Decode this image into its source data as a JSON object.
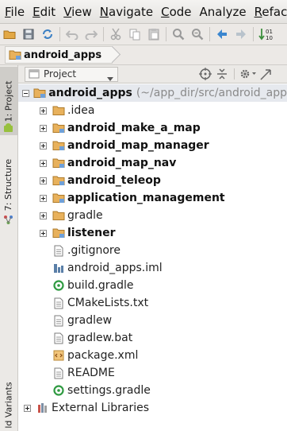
{
  "menu": [
    {
      "mn": "F",
      "rest": "ile"
    },
    {
      "mn": "E",
      "rest": "dit"
    },
    {
      "mn": "V",
      "rest": "iew"
    },
    {
      "mn": "N",
      "rest": "avigate"
    },
    {
      "mn": "C",
      "rest": "ode"
    },
    {
      "mn": "",
      "rest": "Analyze"
    },
    {
      "mn": "R",
      "rest": "efact"
    }
  ],
  "breadcrumb": {
    "label": "android_apps"
  },
  "side_tabs": {
    "project": "1: Project",
    "structure": "7: Structure",
    "variants": "ld Variants"
  },
  "panel": {
    "view_label": "Project"
  },
  "tree": {
    "root": {
      "name": "android_apps",
      "path": "(~/app_dir/src/android_app"
    },
    "items": [
      {
        "name": ".idea",
        "bold": false,
        "expandable": true,
        "icon": "folder-icon"
      },
      {
        "name": "android_make_a_map",
        "bold": true,
        "expandable": true,
        "icon": "module-folder-icon"
      },
      {
        "name": "android_map_manager",
        "bold": true,
        "expandable": true,
        "icon": "module-folder-icon"
      },
      {
        "name": "android_map_nav",
        "bold": true,
        "expandable": true,
        "icon": "module-folder-icon"
      },
      {
        "name": "android_teleop",
        "bold": true,
        "expandable": true,
        "icon": "module-folder-icon"
      },
      {
        "name": "application_management",
        "bold": true,
        "expandable": true,
        "icon": "module-folder-icon"
      },
      {
        "name": "gradle",
        "bold": false,
        "expandable": true,
        "icon": "folder-icon"
      },
      {
        "name": "listener",
        "bold": true,
        "expandable": true,
        "icon": "module-folder-icon"
      },
      {
        "name": ".gitignore",
        "bold": false,
        "expandable": false,
        "icon": "text-file-icon"
      },
      {
        "name": "android_apps.iml",
        "bold": false,
        "expandable": false,
        "icon": "iml-file-icon"
      },
      {
        "name": "build.gradle",
        "bold": false,
        "expandable": false,
        "icon": "gradle-file-icon"
      },
      {
        "name": "CMakeLists.txt",
        "bold": false,
        "expandable": false,
        "icon": "text-file-icon"
      },
      {
        "name": "gradlew",
        "bold": false,
        "expandable": false,
        "icon": "text-file-icon"
      },
      {
        "name": "gradlew.bat",
        "bold": false,
        "expandable": false,
        "icon": "text-file-icon"
      },
      {
        "name": "package.xml",
        "bold": false,
        "expandable": false,
        "icon": "xml-file-icon"
      },
      {
        "name": "README",
        "bold": false,
        "expandable": false,
        "icon": "text-file-icon"
      },
      {
        "name": "settings.gradle",
        "bold": false,
        "expandable": false,
        "icon": "gradle-file-icon"
      }
    ],
    "external": {
      "name": "External Libraries",
      "icon": "library-icon"
    }
  }
}
